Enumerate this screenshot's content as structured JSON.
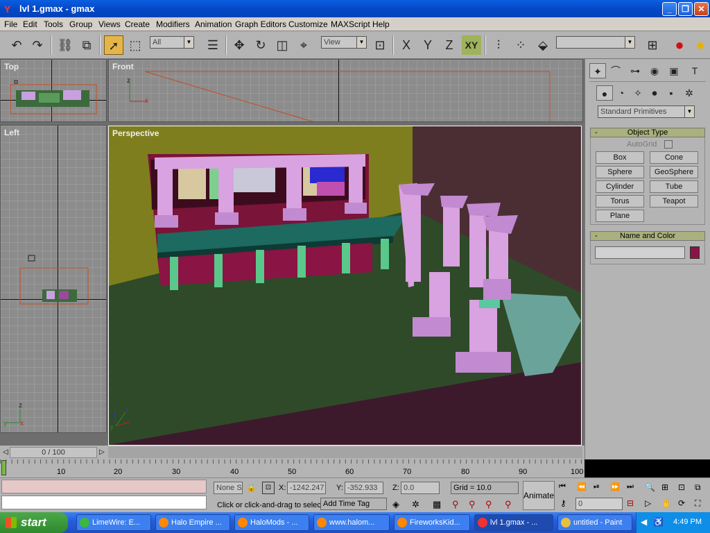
{
  "window": {
    "title": "lvl 1.gmax - gmax",
    "min": "_",
    "max": "❐",
    "close": "✕"
  },
  "menu": [
    "File",
    "Edit",
    "Tools",
    "Group",
    "Views",
    "Create",
    "Modifiers",
    "Animation",
    "Graph Editors",
    "Customize",
    "MAXScript",
    "Help"
  ],
  "toolbar": {
    "selection_filter": "All",
    "ref_coord": "View",
    "axis_x": "X",
    "axis_y": "Y",
    "axis_z": "Z",
    "axis_xy": "XY",
    "named_selection": ""
  },
  "viewports": {
    "top": "Top",
    "front": "Front",
    "left": "Left",
    "perspective": "Perspective"
  },
  "command_panel": {
    "category": "Standard Primitives",
    "object_type_header": "Object Type",
    "autogrid": "AutoGrid",
    "buttons": [
      "Box",
      "Cone",
      "Sphere",
      "GeoSphere",
      "Cylinder",
      "Tube",
      "Torus",
      "Teapot",
      "Plane"
    ],
    "name_color_header": "Name and Color",
    "name_value": "",
    "swatch_color": "#8a1444"
  },
  "timeline": {
    "frame_counter": "0 / 100",
    "ticks": [
      "10",
      "20",
      "30",
      "40",
      "50",
      "60",
      "70",
      "80",
      "90",
      "100"
    ]
  },
  "status": {
    "selection": "None S",
    "x_label": "X:",
    "x_value": "-1242.247",
    "y_label": "Y:",
    "y_value": "-352.933",
    "z_label": "Z:",
    "z_value": "0.0",
    "grid": "Grid = 10.0",
    "prompt": "Click or click-and-drag to selec",
    "time_tag": "Add Time Tag",
    "animate": "Animate",
    "current_frame": "0"
  },
  "taskbar": {
    "start": "start",
    "tasks": [
      "LimeWire: E...",
      "Halo Empire ...",
      "HaloMods - ...",
      "www.halom...",
      "FireworksKid...",
      "lvl 1.gmax - ...",
      "untitled - Paint"
    ],
    "clock": "4:49 PM"
  }
}
